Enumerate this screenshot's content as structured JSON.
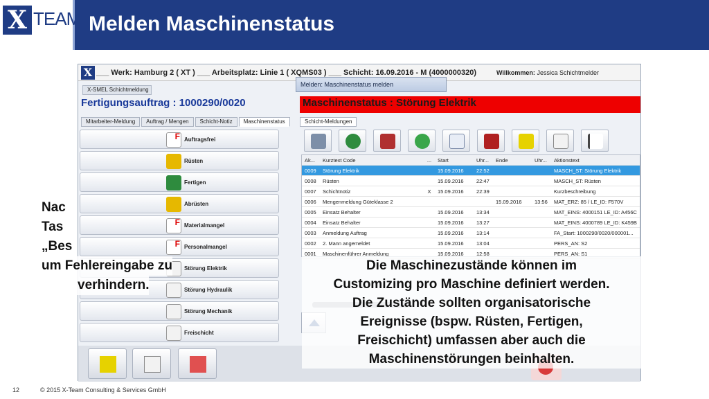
{
  "header": {
    "logo_x": "X",
    "logo_team": "TEAM",
    "title": "Melden Maschinenstatus"
  },
  "app": {
    "logo": "X",
    "werk_line": "___ Werk: Hamburg 2 ( XT ) ___ Arbeitsplatz: Linie 1 ( XQMS03 ) ___ Schicht: 16.09.2016 - M (4000000320)",
    "welcome_prefix": "Willkommen:",
    "welcome_user": "Jessica Schichtmelder",
    "app_tab": "X-SMEL Schichtmeldung",
    "dialog_title": "Melden: Maschinenstatus melden",
    "order": "Fertigungsauftrag : 1000290/0020",
    "status": "Maschinenstatus : Störung Elektrik",
    "left_tabs": [
      "Mitarbeiter-Meldung",
      "Auftrag / Mengen",
      "Schicht-Notiz",
      "Maschinenstatus"
    ],
    "right_tab": "Schicht-Meldungen",
    "left_buttons": [
      "Auftragsfrei",
      "Rüsten",
      "Fertigen",
      "Abrüsten",
      "Materialmangel",
      "Personalmangel",
      "Störung Elektrik",
      "Störung Hydraulik",
      "Störung Mechanik",
      "Freischicht"
    ],
    "grid_headers": [
      "Ak...",
      "Kurztext Code",
      "...",
      "Start",
      "Uhr...",
      "Ende",
      "Uhr...",
      "Aktionstext"
    ],
    "grid_rows": [
      [
        "0009",
        "Störung Elektrik",
        "",
        "15.09.2016",
        "22:52",
        "",
        "",
        "MASCH_ST: Störung Elektrik"
      ],
      [
        "0008",
        "Rüsten",
        "",
        "15.09.2016",
        "22:47",
        "",
        "",
        "MASCH_ST: Rüsten"
      ],
      [
        "0007",
        "Schichtnotiz",
        "X",
        "15.09.2016",
        "22:39",
        "",
        "",
        "Kurzbeschreibung"
      ],
      [
        "0006",
        "Mengenmeldung Güteklasse 2",
        "",
        "",
        "",
        "15.09.2016",
        "13:56",
        "MAT_ERZ: 85 / LE_ID: F570V"
      ],
      [
        "0005",
        "Einsatz Behalter",
        "",
        "15.09.2016",
        "13:34",
        "",
        "",
        "MAT_EINS: 4000151 LE_ID: A456C"
      ],
      [
        "0004",
        "Einsatz Behalter",
        "",
        "15.09.2016",
        "13:27",
        "",
        "",
        "MAT_EINS: 4000789 LE_ID: K459B"
      ],
      [
        "0003",
        "Anmeldung Auftrag",
        "",
        "15.09.2016",
        "13:14",
        "",
        "",
        "FA_Start: 1000290/0020/000001..."
      ],
      [
        "0002",
        "2. Mann angemeldet",
        "",
        "15.09.2016",
        "13:04",
        "",
        "",
        "PERS_AN: S2"
      ],
      [
        "0001",
        "Maschinenführer Anmeldung",
        "",
        "15.09.2016",
        "12:58",
        "",
        "",
        "PERS_AN: S1"
      ]
    ]
  },
  "overlay_left": [
    "Nac",
    "Tas",
    "„Bes",
    "um Fehlereingabe zu",
    "verhindern."
  ],
  "overlay_right": [
    "Die Maschinezustände können im",
    "Customizing pro Maschine definiert werden.",
    "Die Zustände sollten organisatorische",
    "Ereignisse (bspw. Rüsten, Fertigen,",
    "Freischicht) umfassen aber auch die",
    "Maschinenstörungen beinhalten."
  ],
  "footer": {
    "page": "12",
    "copyright": "© 2015  X-Team Consulting & Services GmbH"
  },
  "colors": {
    "brand": "#1f3c84",
    "status_red": "#ee0000",
    "selected_row": "#3399e0"
  }
}
